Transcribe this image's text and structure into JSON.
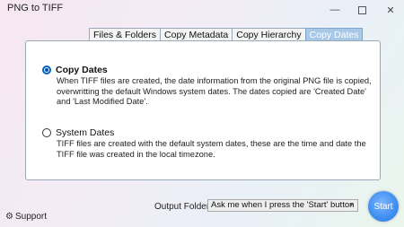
{
  "window": {
    "title": "PNG to TIFF",
    "min_glyph": "—",
    "close_glyph": "✕"
  },
  "tabs": [
    {
      "label": "Files & Folders",
      "active": false
    },
    {
      "label": "Copy Metadata",
      "active": false
    },
    {
      "label": "Copy Hierarchy",
      "active": false
    },
    {
      "label": "Copy Dates",
      "active": true
    }
  ],
  "options": {
    "copy_dates": {
      "title": "Copy Dates",
      "selected": true,
      "description": "When TIFF files are created, the date information from the original PNG file is copied, overwritting the default Windows system dates. The dates copied are 'Created Date' and 'Last Modified Date'."
    },
    "system_dates": {
      "title": "System Dates",
      "selected": false,
      "description": "TIFF files are created with the default system dates, these are the time and date the TIFF file was created in the local timezone."
    }
  },
  "footer": {
    "support_label": "Support",
    "output_folder_label": "Output Folder:",
    "output_folder_value": "Ask me when I press the 'Start' button",
    "start_label": "Start"
  },
  "colors": {
    "accent": "#0060c0",
    "active_tab": "#a8c8e8",
    "start_button": "#3e8ef0"
  },
  "icons": [
    "minimize-icon",
    "maximize-icon",
    "close-icon",
    "gear-icon",
    "chevron-down-icon"
  ]
}
